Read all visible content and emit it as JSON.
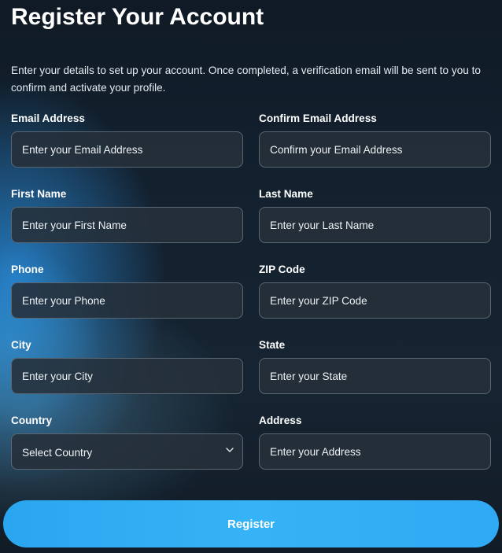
{
  "form": {
    "title": "Register Your Account",
    "description": "Enter your details to set up your account. Once completed, a verification email will be sent to you to confirm and activate your profile.",
    "email": {
      "label": "Email Address",
      "placeholder": "Enter your Email Address",
      "value": ""
    },
    "confirm_email": {
      "label": "Confirm Email Address",
      "placeholder": "Confirm your Email Address",
      "value": ""
    },
    "first_name": {
      "label": "First Name",
      "placeholder": "Enter your First Name",
      "value": ""
    },
    "last_name": {
      "label": "Last Name",
      "placeholder": "Enter your Last Name",
      "value": ""
    },
    "phone": {
      "label": "Phone",
      "placeholder": "Enter your Phone",
      "value": ""
    },
    "zip": {
      "label": "ZIP Code",
      "placeholder": "Enter your ZIP Code",
      "value": ""
    },
    "city": {
      "label": "City",
      "placeholder": "Enter your City",
      "value": ""
    },
    "state": {
      "label": "State",
      "placeholder": "Enter your State",
      "value": ""
    },
    "country": {
      "label": "Country",
      "selected": "Select Country",
      "icon": "chevron-down-icon"
    },
    "address": {
      "label": "Address",
      "placeholder": "Enter your Address",
      "value": ""
    },
    "submit_label": "Register"
  },
  "colors": {
    "accent": "#2aa6f0",
    "input_bg": "#26303a",
    "input_border": "#5a6672",
    "page_bg": "#16202b"
  }
}
